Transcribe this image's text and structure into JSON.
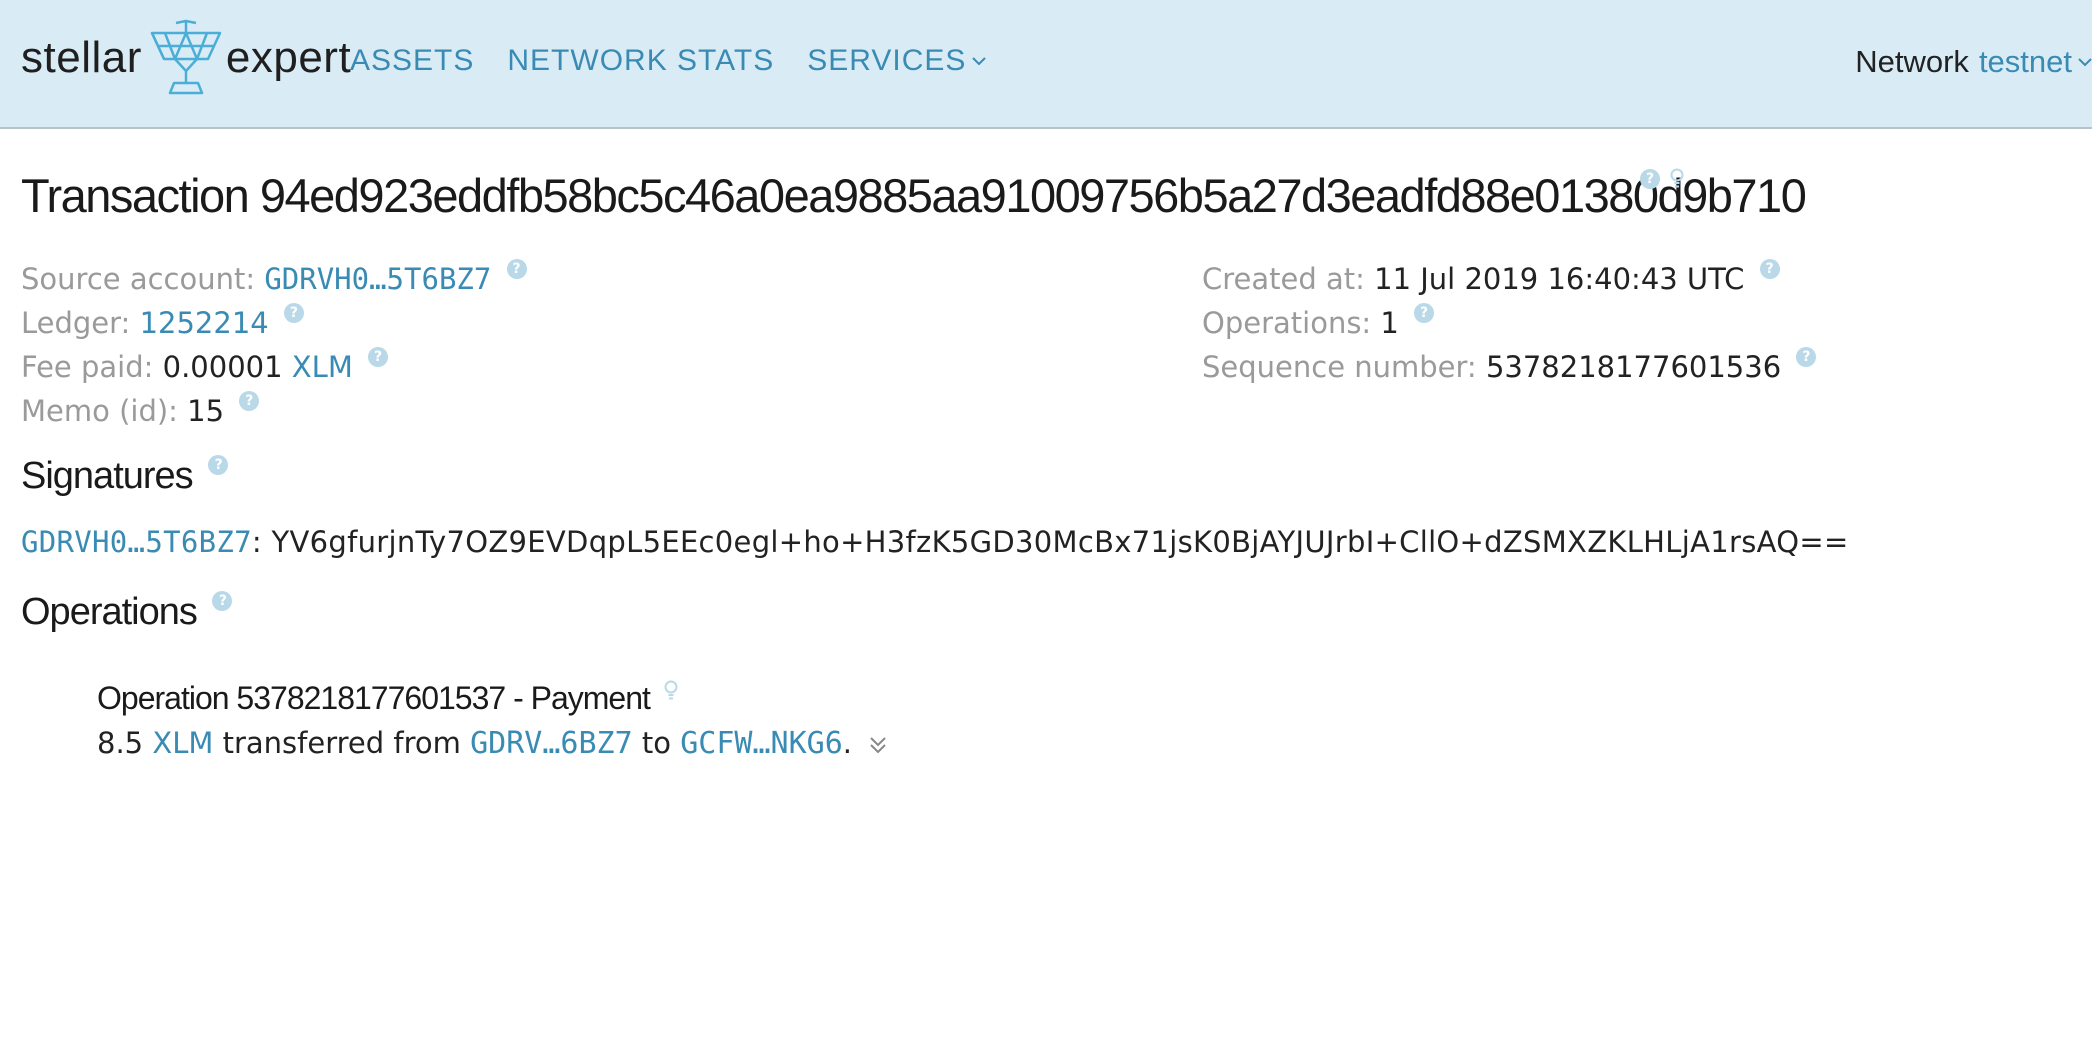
{
  "header": {
    "logo_left": "stellar",
    "logo_right": "expert",
    "nav": {
      "assets": "ASSETS",
      "network_stats": "NETWORK STATS",
      "services": "SERVICES"
    },
    "network_label": "Network",
    "network_value": "testnet"
  },
  "transaction": {
    "title": "Transaction 94ed923eddfb58bc5c46a0ea9885aa91009756b5a27d3eadfd88e01380d9b710",
    "source_account_label": "Source account:",
    "source_account": "GDRVH0…5T6BZ7",
    "ledger_label": "Ledger:",
    "ledger": "1252214",
    "fee_label": "Fee paid:",
    "fee_amount": "0.00001",
    "fee_asset": "XLM",
    "memo_label": "Memo (id):",
    "memo": "15",
    "created_label": "Created at:",
    "created": "11 Jul 2019 16:40:43 UTC",
    "operations_label": "Operations:",
    "operations_count": "1",
    "sequence_label": "Sequence number:",
    "sequence": "5378218177601536"
  },
  "signatures": {
    "heading": "Signatures",
    "items": [
      {
        "account": "GDRVH0…5T6BZ7",
        "separator": ":",
        "value": "YV6gfurjnTy7OZ9EVDqpL5EEc0egl+ho+H3fzK5GD30McBx71jsK0BjAYJUJrbI+CllO+dZSMXZKLHLjA1rsAQ=="
      }
    ]
  },
  "operations": {
    "heading": "Operations",
    "items": [
      {
        "title": "Operation 5378218177601537 - Payment",
        "amount": "8.5",
        "asset": "XLM",
        "text_transferred": "transferred from",
        "from": "GDRV…6BZ7",
        "text_to": "to",
        "to": "GCFW…NKG6",
        "end": "."
      }
    ]
  },
  "icons": {
    "help": "question-circle-icon",
    "bulb": "lightbulb-icon",
    "chevron": "chevron-down-icon",
    "expand": "double-chevron-down-icon"
  },
  "colors": {
    "header_bg": "#d9ecf6",
    "link": "#3a8bb4",
    "label": "#9a9a9a",
    "help_icon": "#b9d8e8"
  }
}
